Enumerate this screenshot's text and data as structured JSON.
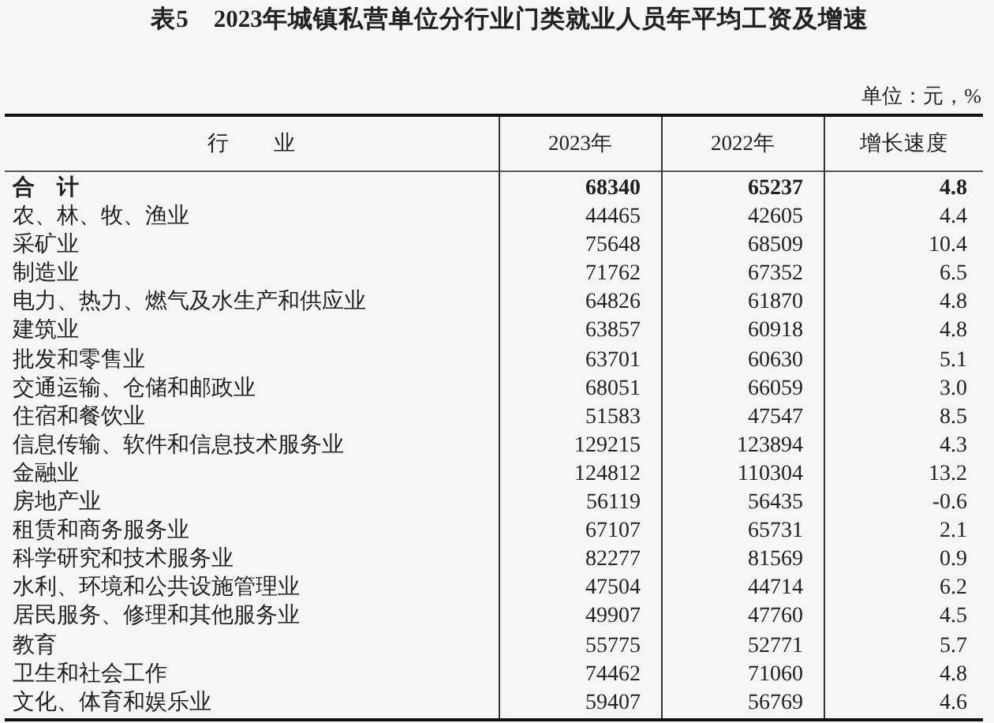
{
  "title": "表5　2023年城镇私营单位分行业门类就业人员年平均工资及增速",
  "unit": "单位：元，%",
  "columns": [
    "行　　业",
    "2023年",
    "2022年",
    "增长速度"
  ],
  "rows": [
    {
      "kind": "total",
      "cells": [
        "合　计",
        "68340",
        "65237",
        "4.8"
      ]
    },
    {
      "kind": "item",
      "cells": [
        "农、林、牧、渔业",
        "44465",
        "42605",
        "4.4"
      ]
    },
    {
      "kind": "item",
      "cells": [
        "采矿业",
        "75648",
        "68509",
        "10.4"
      ]
    },
    {
      "kind": "item",
      "cells": [
        "制造业",
        "71762",
        "67352",
        "6.5"
      ]
    },
    {
      "kind": "item",
      "cells": [
        "电力、热力、燃气及水生产和供应业",
        "64826",
        "61870",
        "4.8"
      ]
    },
    {
      "kind": "item",
      "cells": [
        "建筑业",
        "63857",
        "60918",
        "4.8"
      ]
    },
    {
      "kind": "item",
      "cells": [
        "批发和零售业",
        "63701",
        "60630",
        "5.1"
      ]
    },
    {
      "kind": "item",
      "cells": [
        "交通运输、仓储和邮政业",
        "68051",
        "66059",
        "3.0"
      ]
    },
    {
      "kind": "item",
      "cells": [
        "住宿和餐饮业",
        "51583",
        "47547",
        "8.5"
      ]
    },
    {
      "kind": "item",
      "cells": [
        "信息传输、软件和信息技术服务业",
        "129215",
        "123894",
        "4.3"
      ]
    },
    {
      "kind": "item",
      "cells": [
        "金融业",
        "124812",
        "110304",
        "13.2"
      ]
    },
    {
      "kind": "item",
      "cells": [
        "房地产业",
        "56119",
        "56435",
        "-0.6"
      ]
    },
    {
      "kind": "item",
      "cells": [
        "租赁和商务服务业",
        "67107",
        "65731",
        "2.1"
      ]
    },
    {
      "kind": "item",
      "cells": [
        "科学研究和技术服务业",
        "82277",
        "81569",
        "0.9"
      ]
    },
    {
      "kind": "item",
      "cells": [
        "水利、环境和公共设施管理业",
        "47504",
        "44714",
        "6.2"
      ]
    },
    {
      "kind": "item",
      "cells": [
        "居民服务、修理和其他服务业",
        "49907",
        "47760",
        "4.5"
      ]
    },
    {
      "kind": "item",
      "cells": [
        "教育",
        "55775",
        "52771",
        "5.7"
      ]
    },
    {
      "kind": "item",
      "cells": [
        "卫生和社会工作",
        "74462",
        "71060",
        "4.8"
      ]
    },
    {
      "kind": "item",
      "cells": [
        "文化、体育和娱乐业",
        "59407",
        "56769",
        "4.6"
      ]
    }
  ]
}
